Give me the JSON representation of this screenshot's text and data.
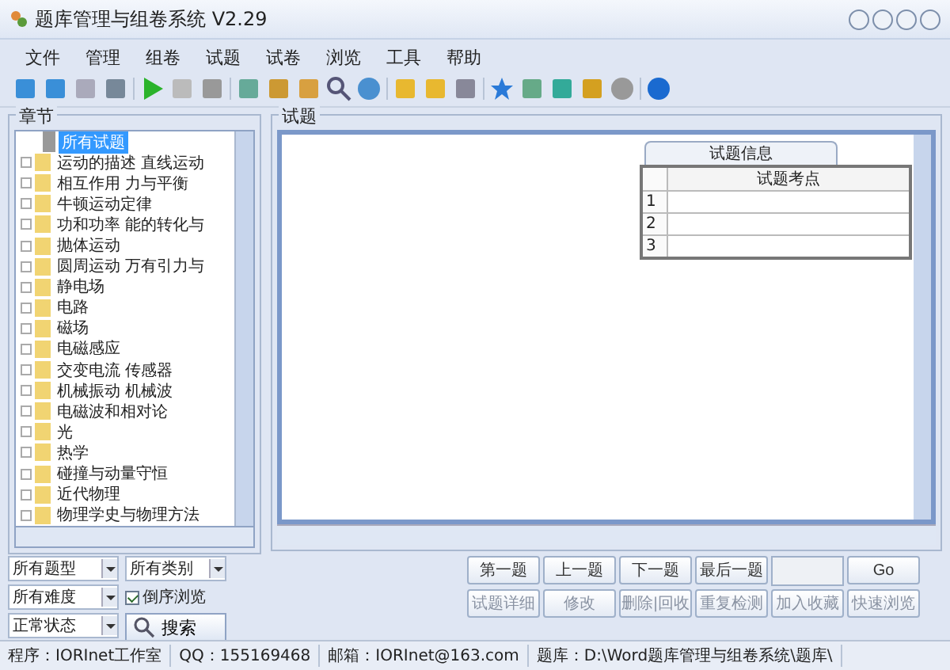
{
  "window": {
    "title": "题库管理与组卷系统 V2.29"
  },
  "menu": [
    "文件",
    "管理",
    "组卷",
    "试题",
    "试卷",
    "浏览",
    "工具",
    "帮助"
  ],
  "chapters": {
    "title": "章节",
    "root": {
      "label": "所有试题",
      "selected": true
    },
    "items": [
      {
        "label": "运动的描述 直线运动",
        "selected": false
      },
      {
        "label": "相互作用 力与平衡",
        "selected": false
      },
      {
        "label": "牛顿运动定律",
        "selected": false
      },
      {
        "label": "功和功率 能的转化与",
        "selected": false
      },
      {
        "label": "抛体运动",
        "selected": false
      },
      {
        "label": "圆周运动 万有引力与",
        "selected": false
      },
      {
        "label": "静电场",
        "selected": false
      },
      {
        "label": "电路",
        "selected": false
      },
      {
        "label": "磁场",
        "selected": false
      },
      {
        "label": "电磁感应",
        "selected": false
      },
      {
        "label": "交变电流 传感器",
        "selected": false
      },
      {
        "label": "机械振动 机械波",
        "selected": false
      },
      {
        "label": "电磁波和相对论",
        "selected": false
      },
      {
        "label": "光",
        "selected": false
      },
      {
        "label": "热学",
        "selected": false
      },
      {
        "label": "碰撞与动量守恒",
        "selected": false
      },
      {
        "label": "近代物理",
        "selected": false
      },
      {
        "label": "物理学史与物理方法",
        "selected": false
      }
    ]
  },
  "filters": {
    "type": "所有题型",
    "category": "所有类别",
    "difficulty": "所有难度",
    "reverse": {
      "label": "倒序浏览",
      "checked": true
    },
    "status": "正常状态",
    "search": "搜索"
  },
  "questions": {
    "title": "试题",
    "info_tab": "试题信息",
    "table": {
      "columns": [
        "试题考点"
      ],
      "rows": [
        "1",
        "2",
        "3"
      ]
    }
  },
  "nav_buttons": [
    {
      "label": "第一题",
      "disabled": false
    },
    {
      "label": "上一题",
      "disabled": false
    },
    {
      "label": "下一题",
      "disabled": false
    },
    {
      "label": "最后一题",
      "disabled": false
    }
  ],
  "go": "Go",
  "action_buttons": [
    {
      "label": "试题详细",
      "disabled": true
    },
    {
      "label": "修改",
      "disabled": true
    },
    {
      "label": "删除|回收",
      "disabled": true
    },
    {
      "label": "重复检测",
      "disabled": true
    },
    {
      "label": "加入收藏",
      "disabled": true
    },
    {
      "label": "快速浏览",
      "disabled": true
    }
  ],
  "status_bar": [
    "程序：IORInet工作室",
    "QQ：155169468",
    "邮箱：IORInet@163.com",
    "题库：D:\\Word题库管理与组卷系统\\题库\\"
  ]
}
